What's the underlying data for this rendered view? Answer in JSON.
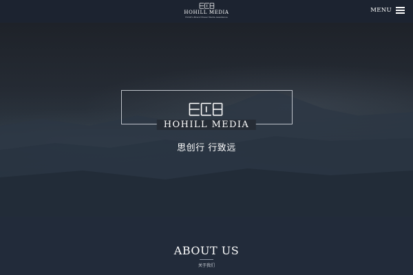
{
  "header": {
    "brand": "HOHILL MEDIA",
    "tagline": "Hohill's Brand Power Media Assistance",
    "menu_label": "MENU",
    "logo_icon": "hohill-logo-mark",
    "menu_icon": "hamburger-icon"
  },
  "hero": {
    "brand": "HOHILL MEDIA",
    "slogan": "思创行 行致远",
    "background": "misty-mountain-landscape"
  },
  "about": {
    "title": "ABOUT US",
    "subtitle": "关于我们"
  },
  "colors": {
    "header_bg": "#1c2330",
    "about_bg": "#222b3a",
    "text": "#ffffff",
    "frame": "#bfc4cb"
  }
}
